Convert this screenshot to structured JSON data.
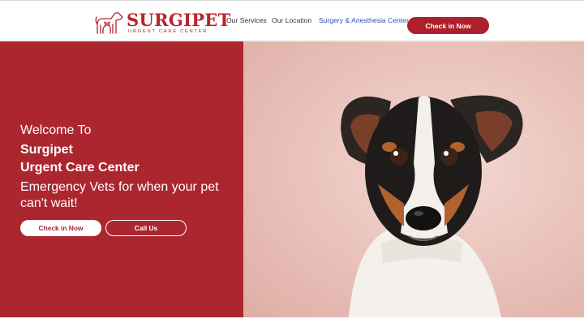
{
  "brand": {
    "name": "SURGIPET",
    "tagline": "URGENT CARE CENTER",
    "color": "#b8242c"
  },
  "nav": {
    "items": [
      "Our Services",
      "Our Location",
      "Surgery & Anesthesia Center"
    ],
    "cta": "Check in Now"
  },
  "hero": {
    "welcome": "Welcome To",
    "title_line1": "Surgipet",
    "title_line2": "Urgent Care Center",
    "subtitle": "Emergency Vets for when your pet can't wait!",
    "primary_button": "Check in Now",
    "secondary_button": "Call Us",
    "panel_color": "#ac2630",
    "image": "dog-photo"
  }
}
